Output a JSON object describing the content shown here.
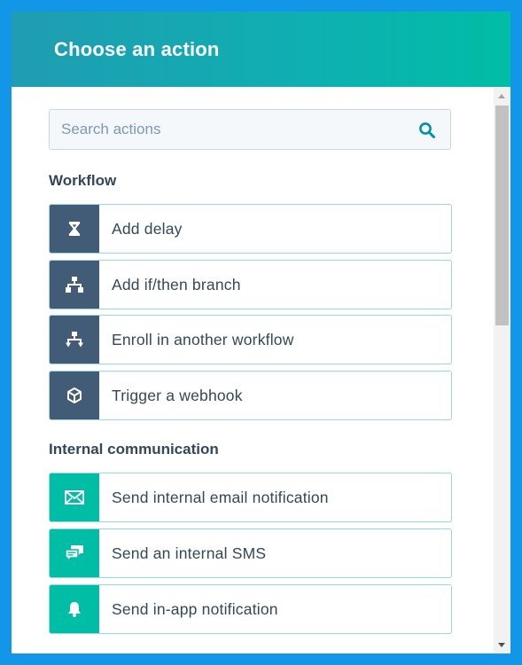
{
  "dialog": {
    "title": "Choose an action"
  },
  "search": {
    "placeholder": "Search actions",
    "icon": "search-icon"
  },
  "sections": [
    {
      "title": "Workflow",
      "items": [
        {
          "label": "Add delay",
          "icon": "hourglass-icon"
        },
        {
          "label": "Add if/then branch",
          "icon": "branch-icon"
        },
        {
          "label": "Enroll in another workflow",
          "icon": "workflow-icon"
        },
        {
          "label": "Trigger a webhook",
          "icon": "cube-icon"
        }
      ]
    },
    {
      "title": "Internal communication",
      "items": [
        {
          "label": "Send internal email notification",
          "icon": "envelope-icon"
        },
        {
          "label": "Send an internal SMS",
          "icon": "chat-bubble-icon"
        },
        {
          "label": "Send in-app notification",
          "icon": "bell-icon"
        }
      ]
    }
  ],
  "colors": {
    "header_start": "#1f9db1",
    "header_end": "#00bda5",
    "workflow_icon_bg": "#425b76",
    "internal_icon_bg": "#00bda5",
    "text": "#33475b",
    "border_accent": "#99d7e3"
  }
}
